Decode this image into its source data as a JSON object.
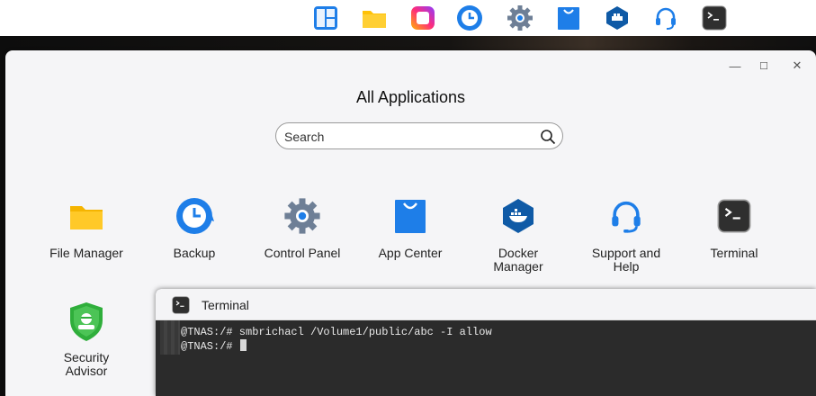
{
  "dock": {
    "icons": [
      "tiles-icon",
      "folder-icon",
      "photos-icon",
      "backup-icon",
      "gear-icon",
      "app-center-icon",
      "docker-icon",
      "headset-icon",
      "terminal-icon"
    ]
  },
  "window": {
    "title": "All Applications",
    "controls": {
      "minimize": "—",
      "maximize": "☐",
      "close": "✕"
    }
  },
  "search": {
    "placeholder": "Search"
  },
  "apps": [
    {
      "label": "File Manager",
      "icon": "folder-icon"
    },
    {
      "label": "Backup",
      "icon": "backup-icon"
    },
    {
      "label": "Control Panel",
      "icon": "gear-icon"
    },
    {
      "label": "App Center",
      "icon": "app-center-icon"
    },
    {
      "label": "Docker Manager",
      "icon": "docker-icon"
    },
    {
      "label": "Support and Help",
      "icon": "headset-icon"
    },
    {
      "label": "Terminal",
      "icon": "terminal-icon"
    },
    {
      "label": "Security Advisor",
      "icon": "shield-icon"
    }
  ],
  "terminal": {
    "title": "Terminal",
    "lines": [
      "@TNAS:/# smbrichacl /Volume1/public/abc -I allow",
      "@TNAS:/# "
    ]
  },
  "colors": {
    "accent_blue": "#1e7ee8",
    "folder_yellow": "#ffc107",
    "terminal_bg": "#2b2b2b",
    "security_green": "#2fae3b"
  }
}
